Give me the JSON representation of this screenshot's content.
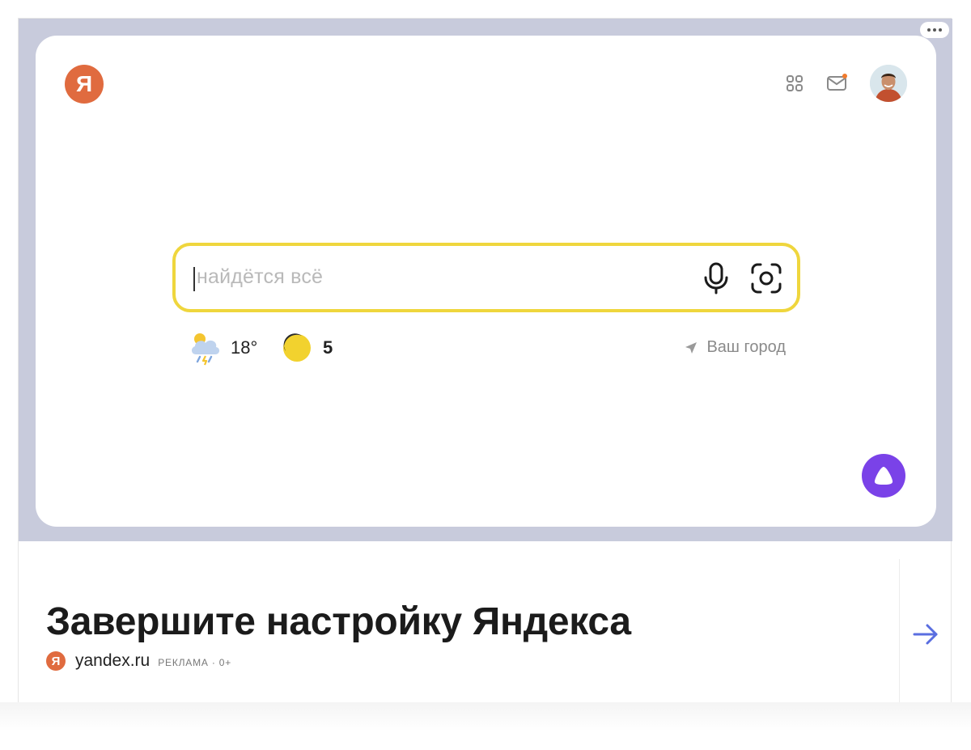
{
  "browser": {
    "logo_letter": "Я",
    "search": {
      "placeholder": "найдётся всё"
    },
    "weather": {
      "temperature": "18°"
    },
    "traffic": {
      "score": "5"
    },
    "location": {
      "label": "Ваш город"
    },
    "icons": {
      "apps": "apps-grid-icon",
      "mail": "mail-icon",
      "mic": "microphone-icon",
      "camera": "camera-search-icon",
      "alice": "alice-assistant-icon"
    }
  },
  "ad": {
    "title": "Завершите настройку Яндекса",
    "source_logo_letter": "Я",
    "domain": "yandex.ru",
    "label": "РЕКЛАМА · 0+"
  },
  "colors": {
    "brand": "#e06b3f",
    "search_border": "#efd63d",
    "alice": "#7a42e8",
    "arrow": "#5a6ee0",
    "image_frame": "#c8cbdc"
  }
}
